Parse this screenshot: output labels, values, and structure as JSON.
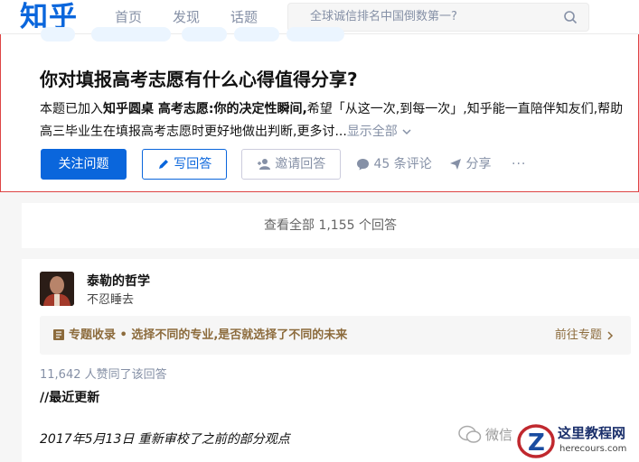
{
  "header": {
    "logo": "知乎",
    "nav": [
      "首页",
      "发现",
      "话题"
    ],
    "search_placeholder": "全球诚信排名中国倒数第一?"
  },
  "question": {
    "title": "你对填报高考志愿有什么心得值得分享?",
    "desc_prefix": "本题已加入",
    "desc_bold": "知乎圆桌 高考志愿:你的决定性瞬间,",
    "desc_rest": "希望「从这一次,到每一次」,知乎能一直陪伴知友们,帮助高三毕业生在填报高考志愿时更好地做出判断,更多讨...",
    "show_all": "显示全部",
    "follow_label": "关注问题",
    "write_label": "写回答",
    "invite_label": "邀请回答",
    "comments_label": "45 条评论",
    "share_label": "分享",
    "more_label": "···"
  },
  "view_all": "查看全部 1,155 个回答",
  "answer": {
    "author": "泰勒的哲学",
    "headline": "不忍睡去",
    "special_text": "专题收录 • 选择不同的专业,是否就选择了不同的未来",
    "special_go": "前往专题",
    "votes": "11,642 人赞同了该回答",
    "latest": "//最近更新",
    "date_line": "2017年5月13日 重新审校了之前的部分观点"
  },
  "watermark": {
    "wechat": "微信",
    "site": "这里教程网",
    "url": "herecours.com"
  },
  "colors": {
    "brand": "#0a66dc",
    "special": "#8c6b3c"
  }
}
